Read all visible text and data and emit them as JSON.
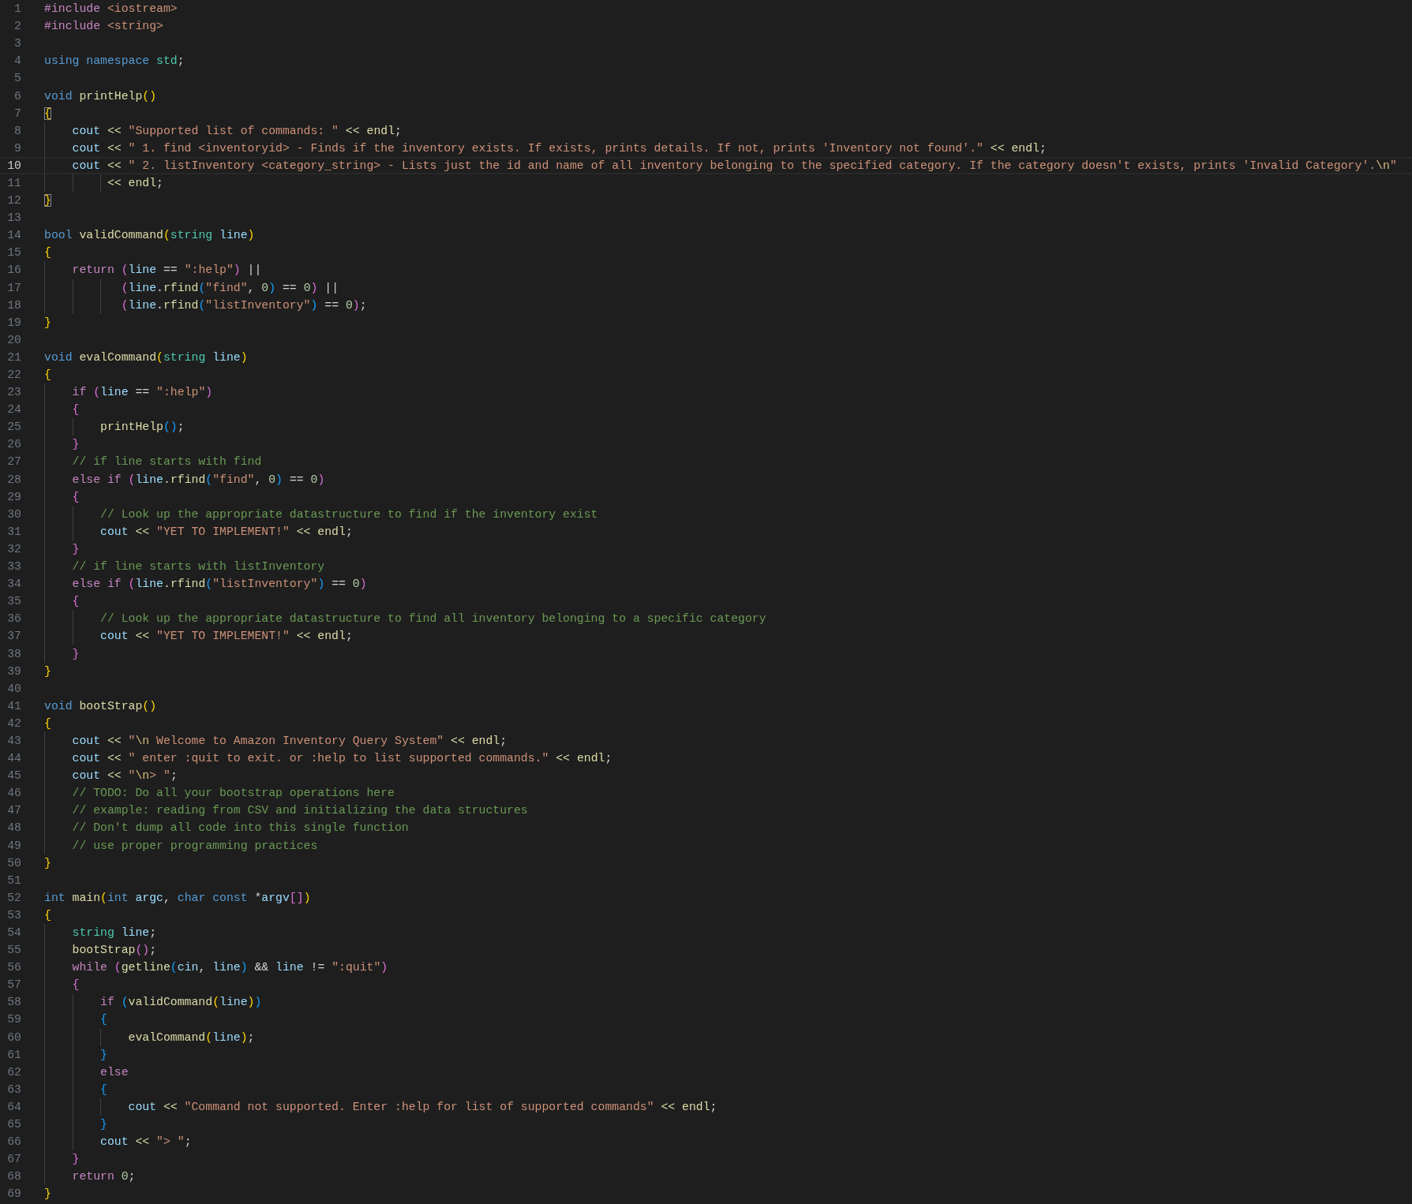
{
  "editor": {
    "lines": [
      {
        "number": "1",
        "current": false,
        "tokens": [
          {
            "text": "#include",
            "kind": "pp"
          },
          {
            "text": " <iostream>",
            "kind": "str"
          }
        ]
      },
      {
        "number": "2",
        "current": false,
        "tokens": [
          {
            "text": "#include",
            "kind": "pp"
          },
          {
            "text": " <string>",
            "kind": "str"
          }
        ]
      },
      {
        "number": "3",
        "current": false
      },
      {
        "number": "4",
        "current": false,
        "tokens": [
          {
            "text": "using",
            "kind": "kw"
          },
          {
            "text": " namespace",
            "kind": "kw"
          },
          {
            "text": " std",
            "kind": "type"
          },
          {
            "text": ";",
            "kind": "op"
          }
        ]
      },
      {
        "number": "5",
        "current": false
      },
      {
        "number": "6",
        "current": false,
        "tokens": [
          {
            "text": "void",
            "kind": "kw"
          },
          {
            "text": " printHelp",
            "kind": "fn"
          },
          {
            "text": "()",
            "kind": "b1"
          }
        ]
      },
      {
        "number": "7",
        "current": false,
        "tokens": [
          {
            "text": "{",
            "kind": "b1",
            "matched": true
          }
        ]
      },
      {
        "number": "8",
        "current": false,
        "tokens": [
          {
            "text": "    cout",
            "kind": "var"
          },
          {
            "text": " << ",
            "kind": "opf"
          },
          {
            "text": "\"Supported list of commands: \"",
            "kind": "str"
          },
          {
            "text": " << ",
            "kind": "opf"
          },
          {
            "text": "endl",
            "kind": "fn"
          },
          {
            "text": ";",
            "kind": "op"
          }
        ]
      },
      {
        "number": "9",
        "current": false,
        "tokens": [
          {
            "text": "    cout",
            "kind": "var"
          },
          {
            "text": " << ",
            "kind": "opf"
          },
          {
            "text": "\" 1. find <inventoryid> - Finds if the inventory exists. If exists, prints details. If not, prints 'Inventory not found'.\"",
            "kind": "str"
          },
          {
            "text": " << ",
            "kind": "opf"
          },
          {
            "text": "endl",
            "kind": "fn"
          },
          {
            "text": ";",
            "kind": "op"
          }
        ]
      },
      {
        "number": "10",
        "current": true,
        "tokens": [
          {
            "text": "    cout",
            "kind": "var"
          },
          {
            "text": " << ",
            "kind": "opf"
          },
          {
            "text": "\" 2. listInventory <category_string> - Lists just the id and name of all inventory belonging to the specified category. If the category doesn't exists, prints 'Invalid Category'.",
            "kind": "str"
          },
          {
            "text": "\\n",
            "kind": "esc"
          },
          {
            "text": "\"",
            "kind": "str"
          }
        ]
      },
      {
        "number": "11",
        "current": false,
        "tokens": [
          {
            "text": "         << ",
            "kind": "opf"
          },
          {
            "text": "endl",
            "kind": "fn"
          },
          {
            "text": ";",
            "kind": "op"
          }
        ]
      },
      {
        "number": "12",
        "current": false,
        "tokens": [
          {
            "text": "}",
            "kind": "b1",
            "matched": true
          }
        ]
      },
      {
        "number": "13",
        "current": false
      },
      {
        "number": "14",
        "current": false,
        "tokens": [
          {
            "text": "bool",
            "kind": "kw"
          },
          {
            "text": " validCommand",
            "kind": "fn"
          },
          {
            "text": "(",
            "kind": "b1"
          },
          {
            "text": "string",
            "kind": "type"
          },
          {
            "text": " line",
            "kind": "var"
          },
          {
            "text": ")",
            "kind": "b1"
          }
        ]
      },
      {
        "number": "15",
        "current": false,
        "tokens": [
          {
            "text": "{",
            "kind": "b1"
          }
        ]
      },
      {
        "number": "16",
        "current": false,
        "tokens": [
          {
            "text": "    return",
            "kind": "ctl"
          },
          {
            "text": " (",
            "kind": "b2"
          },
          {
            "text": "line",
            "kind": "var"
          },
          {
            "text": " == ",
            "kind": "op"
          },
          {
            "text": "\":help\"",
            "kind": "str"
          },
          {
            "text": ")",
            "kind": "b2"
          },
          {
            "text": " ||",
            "kind": "op"
          }
        ]
      },
      {
        "number": "17",
        "current": false,
        "tokens": [
          {
            "text": "           (",
            "kind": "b2"
          },
          {
            "text": "line",
            "kind": "var"
          },
          {
            "text": ".",
            "kind": "op"
          },
          {
            "text": "rfind",
            "kind": "fn"
          },
          {
            "text": "(",
            "kind": "b3"
          },
          {
            "text": "\"find\"",
            "kind": "str"
          },
          {
            "text": ", ",
            "kind": "op"
          },
          {
            "text": "0",
            "kind": "num"
          },
          {
            "text": ")",
            "kind": "b3"
          },
          {
            "text": " == ",
            "kind": "op"
          },
          {
            "text": "0",
            "kind": "num"
          },
          {
            "text": ")",
            "kind": "b2"
          },
          {
            "text": " ||",
            "kind": "op"
          }
        ]
      },
      {
        "number": "18",
        "current": false,
        "tokens": [
          {
            "text": "           (",
            "kind": "b2"
          },
          {
            "text": "line",
            "kind": "var"
          },
          {
            "text": ".",
            "kind": "op"
          },
          {
            "text": "rfind",
            "kind": "fn"
          },
          {
            "text": "(",
            "kind": "b3"
          },
          {
            "text": "\"listInventory\"",
            "kind": "str"
          },
          {
            "text": ")",
            "kind": "b3"
          },
          {
            "text": " == ",
            "kind": "op"
          },
          {
            "text": "0",
            "kind": "num"
          },
          {
            "text": ")",
            "kind": "b2"
          },
          {
            "text": ";",
            "kind": "op"
          }
        ]
      },
      {
        "number": "19",
        "current": false,
        "tokens": [
          {
            "text": "}",
            "kind": "b1"
          }
        ]
      },
      {
        "number": "20",
        "current": false
      },
      {
        "number": "21",
        "current": false,
        "tokens": [
          {
            "text": "void",
            "kind": "kw"
          },
          {
            "text": " evalCommand",
            "kind": "fn"
          },
          {
            "text": "(",
            "kind": "b1"
          },
          {
            "text": "string",
            "kind": "type"
          },
          {
            "text": " line",
            "kind": "var"
          },
          {
            "text": ")",
            "kind": "b1"
          }
        ]
      },
      {
        "number": "22",
        "current": false,
        "tokens": [
          {
            "text": "{",
            "kind": "b1"
          }
        ]
      },
      {
        "number": "23",
        "current": false,
        "tokens": [
          {
            "text": "    if",
            "kind": "ctl"
          },
          {
            "text": " (",
            "kind": "b2"
          },
          {
            "text": "line",
            "kind": "var"
          },
          {
            "text": " == ",
            "kind": "op"
          },
          {
            "text": "\":help\"",
            "kind": "str"
          },
          {
            "text": ")",
            "kind": "b2"
          }
        ]
      },
      {
        "number": "24",
        "current": false,
        "tokens": [
          {
            "text": "    {",
            "kind": "b2"
          }
        ]
      },
      {
        "number": "25",
        "current": false,
        "tokens": [
          {
            "text": "        printHelp",
            "kind": "fn"
          },
          {
            "text": "()",
            "kind": "b3"
          },
          {
            "text": ";",
            "kind": "op"
          }
        ]
      },
      {
        "number": "26",
        "current": false,
        "tokens": [
          {
            "text": "    }",
            "kind": "b2"
          }
        ]
      },
      {
        "number": "27",
        "current": false,
        "tokens": [
          {
            "text": "    // if line starts with find",
            "kind": "com"
          }
        ]
      },
      {
        "number": "28",
        "current": false,
        "tokens": [
          {
            "text": "    else",
            "kind": "ctl"
          },
          {
            "text": " if",
            "kind": "ctl"
          },
          {
            "text": " (",
            "kind": "b2"
          },
          {
            "text": "line",
            "kind": "var"
          },
          {
            "text": ".",
            "kind": "op"
          },
          {
            "text": "rfind",
            "kind": "fn"
          },
          {
            "text": "(",
            "kind": "b3"
          },
          {
            "text": "\"find\"",
            "kind": "str"
          },
          {
            "text": ", ",
            "kind": "op"
          },
          {
            "text": "0",
            "kind": "num"
          },
          {
            "text": ")",
            "kind": "b3"
          },
          {
            "text": " == ",
            "kind": "op"
          },
          {
            "text": "0",
            "kind": "num"
          },
          {
            "text": ")",
            "kind": "b2"
          }
        ]
      },
      {
        "number": "29",
        "current": false,
        "tokens": [
          {
            "text": "    {",
            "kind": "b2"
          }
        ]
      },
      {
        "number": "30",
        "current": false,
        "tokens": [
          {
            "text": "        // Look up the appropriate datastructure to find if the inventory exist",
            "kind": "com"
          }
        ]
      },
      {
        "number": "31",
        "current": false,
        "tokens": [
          {
            "text": "        cout",
            "kind": "var"
          },
          {
            "text": " << ",
            "kind": "opf"
          },
          {
            "text": "\"YET TO IMPLEMENT!\"",
            "kind": "str"
          },
          {
            "text": " << ",
            "kind": "opf"
          },
          {
            "text": "endl",
            "kind": "fn"
          },
          {
            "text": ";",
            "kind": "op"
          }
        ]
      },
      {
        "number": "32",
        "current": false,
        "tokens": [
          {
            "text": "    }",
            "kind": "b2"
          }
        ]
      },
      {
        "number": "33",
        "current": false,
        "tokens": [
          {
            "text": "    // if line starts with listInventory",
            "kind": "com"
          }
        ]
      },
      {
        "number": "34",
        "current": false,
        "tokens": [
          {
            "text": "    else",
            "kind": "ctl"
          },
          {
            "text": " if",
            "kind": "ctl"
          },
          {
            "text": " (",
            "kind": "b2"
          },
          {
            "text": "line",
            "kind": "var"
          },
          {
            "text": ".",
            "kind": "op"
          },
          {
            "text": "rfind",
            "kind": "fn"
          },
          {
            "text": "(",
            "kind": "b3"
          },
          {
            "text": "\"listInventory\"",
            "kind": "str"
          },
          {
            "text": ")",
            "kind": "b3"
          },
          {
            "text": " == ",
            "kind": "op"
          },
          {
            "text": "0",
            "kind": "num"
          },
          {
            "text": ")",
            "kind": "b2"
          }
        ]
      },
      {
        "number": "35",
        "current": false,
        "tokens": [
          {
            "text": "    {",
            "kind": "b2"
          }
        ]
      },
      {
        "number": "36",
        "current": false,
        "tokens": [
          {
            "text": "        // Look up the appropriate datastructure to find all inventory belonging to a specific category",
            "kind": "com"
          }
        ]
      },
      {
        "number": "37",
        "current": false,
        "tokens": [
          {
            "text": "        cout",
            "kind": "var"
          },
          {
            "text": " << ",
            "kind": "opf"
          },
          {
            "text": "\"YET TO IMPLEMENT!\"",
            "kind": "str"
          },
          {
            "text": " << ",
            "kind": "opf"
          },
          {
            "text": "endl",
            "kind": "fn"
          },
          {
            "text": ";",
            "kind": "op"
          }
        ]
      },
      {
        "number": "38",
        "current": false,
        "tokens": [
          {
            "text": "    }",
            "kind": "b2"
          }
        ]
      },
      {
        "number": "39",
        "current": false,
        "tokens": [
          {
            "text": "}",
            "kind": "b1"
          }
        ]
      },
      {
        "number": "40",
        "current": false
      },
      {
        "number": "41",
        "current": false,
        "tokens": [
          {
            "text": "void",
            "kind": "kw"
          },
          {
            "text": " bootStrap",
            "kind": "fn"
          },
          {
            "text": "()",
            "kind": "b1"
          }
        ]
      },
      {
        "number": "42",
        "current": false,
        "tokens": [
          {
            "text": "{",
            "kind": "b1"
          }
        ]
      },
      {
        "number": "43",
        "current": false,
        "tokens": [
          {
            "text": "    cout",
            "kind": "var"
          },
          {
            "text": " << ",
            "kind": "opf"
          },
          {
            "text": "\"",
            "kind": "str"
          },
          {
            "text": "\\n",
            "kind": "esc"
          },
          {
            "text": " Welcome to Amazon Inventory Query System\"",
            "kind": "str"
          },
          {
            "text": " << ",
            "kind": "opf"
          },
          {
            "text": "endl",
            "kind": "fn"
          },
          {
            "text": ";",
            "kind": "op"
          }
        ]
      },
      {
        "number": "44",
        "current": false,
        "tokens": [
          {
            "text": "    cout",
            "kind": "var"
          },
          {
            "text": " << ",
            "kind": "opf"
          },
          {
            "text": "\" enter :quit to exit. or :help to list supported commands.\"",
            "kind": "str"
          },
          {
            "text": " << ",
            "kind": "opf"
          },
          {
            "text": "endl",
            "kind": "fn"
          },
          {
            "text": ";",
            "kind": "op"
          }
        ]
      },
      {
        "number": "45",
        "current": false,
        "tokens": [
          {
            "text": "    cout",
            "kind": "var"
          },
          {
            "text": " << ",
            "kind": "opf"
          },
          {
            "text": "\"",
            "kind": "str"
          },
          {
            "text": "\\n",
            "kind": "esc"
          },
          {
            "text": "> \"",
            "kind": "str"
          },
          {
            "text": ";",
            "kind": "op"
          }
        ]
      },
      {
        "number": "46",
        "current": false,
        "tokens": [
          {
            "text": "    // TODO: Do all your bootstrap operations here",
            "kind": "com"
          }
        ]
      },
      {
        "number": "47",
        "current": false,
        "tokens": [
          {
            "text": "    // example: reading from CSV and initializing the data structures",
            "kind": "com"
          }
        ]
      },
      {
        "number": "48",
        "current": false,
        "tokens": [
          {
            "text": "    // Don't dump all code into this single function",
            "kind": "com"
          }
        ]
      },
      {
        "number": "49",
        "current": false,
        "tokens": [
          {
            "text": "    // use proper programming practices",
            "kind": "com"
          }
        ]
      },
      {
        "number": "50",
        "current": false,
        "tokens": [
          {
            "text": "}",
            "kind": "b1"
          }
        ]
      },
      {
        "number": "51",
        "current": false
      },
      {
        "number": "52",
        "current": false,
        "tokens": [
          {
            "text": "int",
            "kind": "kw"
          },
          {
            "text": " main",
            "kind": "fn"
          },
          {
            "text": "(",
            "kind": "b1"
          },
          {
            "text": "int",
            "kind": "kw"
          },
          {
            "text": " argc",
            "kind": "var"
          },
          {
            "text": ", ",
            "kind": "op"
          },
          {
            "text": "char",
            "kind": "kw"
          },
          {
            "text": " const",
            "kind": "kw"
          },
          {
            "text": " *",
            "kind": "op"
          },
          {
            "text": "argv",
            "kind": "var"
          },
          {
            "text": "[]",
            "kind": "b2"
          },
          {
            "text": ")",
            "kind": "b1"
          }
        ]
      },
      {
        "number": "53",
        "current": false,
        "tokens": [
          {
            "text": "{",
            "kind": "b1"
          }
        ]
      },
      {
        "number": "54",
        "current": false,
        "tokens": [
          {
            "text": "    string",
            "kind": "type"
          },
          {
            "text": " line",
            "kind": "var"
          },
          {
            "text": ";",
            "kind": "op"
          }
        ]
      },
      {
        "number": "55",
        "current": false,
        "tokens": [
          {
            "text": "    bootStrap",
            "kind": "fn"
          },
          {
            "text": "()",
            "kind": "b2"
          },
          {
            "text": ";",
            "kind": "op"
          }
        ]
      },
      {
        "number": "56",
        "current": false,
        "tokens": [
          {
            "text": "    while",
            "kind": "ctl"
          },
          {
            "text": " (",
            "kind": "b2"
          },
          {
            "text": "getline",
            "kind": "fn"
          },
          {
            "text": "(",
            "kind": "b3"
          },
          {
            "text": "cin",
            "kind": "var"
          },
          {
            "text": ", ",
            "kind": "op"
          },
          {
            "text": "line",
            "kind": "var"
          },
          {
            "text": ")",
            "kind": "b3"
          },
          {
            "text": " && ",
            "kind": "op"
          },
          {
            "text": "line",
            "kind": "var"
          },
          {
            "text": " != ",
            "kind": "op"
          },
          {
            "text": "\":quit\"",
            "kind": "str"
          },
          {
            "text": ")",
            "kind": "b2"
          }
        ]
      },
      {
        "number": "57",
        "current": false,
        "tokens": [
          {
            "text": "    {",
            "kind": "b2"
          }
        ]
      },
      {
        "number": "58",
        "current": false,
        "tokens": [
          {
            "text": "        if",
            "kind": "ctl"
          },
          {
            "text": " (",
            "kind": "b3"
          },
          {
            "text": "validCommand",
            "kind": "fn"
          },
          {
            "text": "(",
            "kind": "b1"
          },
          {
            "text": "line",
            "kind": "var"
          },
          {
            "text": ")",
            "kind": "b1"
          },
          {
            "text": ")",
            "kind": "b3"
          }
        ]
      },
      {
        "number": "59",
        "current": false,
        "tokens": [
          {
            "text": "        {",
            "kind": "b3"
          }
        ]
      },
      {
        "number": "60",
        "current": false,
        "tokens": [
          {
            "text": "            evalCommand",
            "kind": "fn"
          },
          {
            "text": "(",
            "kind": "b1"
          },
          {
            "text": "line",
            "kind": "var"
          },
          {
            "text": ")",
            "kind": "b1"
          },
          {
            "text": ";",
            "kind": "op"
          }
        ]
      },
      {
        "number": "61",
        "current": false,
        "tokens": [
          {
            "text": "        }",
            "kind": "b3"
          }
        ]
      },
      {
        "number": "62",
        "current": false,
        "tokens": [
          {
            "text": "        else",
            "kind": "ctl"
          }
        ]
      },
      {
        "number": "63",
        "current": false,
        "tokens": [
          {
            "text": "        {",
            "kind": "b3"
          }
        ]
      },
      {
        "number": "64",
        "current": false,
        "tokens": [
          {
            "text": "            cout",
            "kind": "var"
          },
          {
            "text": " << ",
            "kind": "opf"
          },
          {
            "text": "\"Command not supported. Enter :help for list of supported commands\"",
            "kind": "str"
          },
          {
            "text": " << ",
            "kind": "opf"
          },
          {
            "text": "endl",
            "kind": "fn"
          },
          {
            "text": ";",
            "kind": "op"
          }
        ]
      },
      {
        "number": "65",
        "current": false,
        "tokens": [
          {
            "text": "        }",
            "kind": "b3"
          }
        ]
      },
      {
        "number": "66",
        "current": false,
        "tokens": [
          {
            "text": "        cout",
            "kind": "var"
          },
          {
            "text": " << ",
            "kind": "opf"
          },
          {
            "text": "\"> \"",
            "kind": "str"
          },
          {
            "text": ";",
            "kind": "op"
          }
        ]
      },
      {
        "number": "67",
        "current": false,
        "tokens": [
          {
            "text": "    }",
            "kind": "b2"
          }
        ]
      },
      {
        "number": "68",
        "current": false,
        "tokens": [
          {
            "text": "    return",
            "kind": "ctl"
          },
          {
            "text": " 0",
            "kind": "num"
          },
          {
            "text": ";",
            "kind": "op"
          }
        ]
      },
      {
        "number": "69",
        "current": false,
        "tokens": [
          {
            "text": "}",
            "kind": "b1"
          }
        ]
      }
    ]
  }
}
